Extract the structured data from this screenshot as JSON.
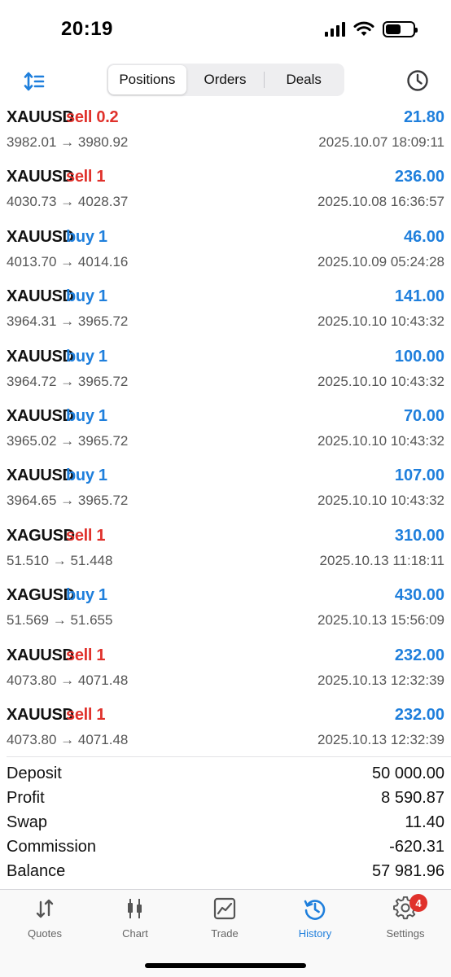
{
  "status": {
    "time": "20:19"
  },
  "tabs": [
    {
      "label": "Positions",
      "active": true
    },
    {
      "label": "Orders",
      "active": false
    },
    {
      "label": "Deals",
      "active": false
    }
  ],
  "trades": [
    {
      "symbol": "XAUUSD",
      "side": "sell",
      "volume": "sell 0.2",
      "profit": "21.80",
      "prices": "3982.01 → 3980.92",
      "datetime": "2025.10.07 18:09:11"
    },
    {
      "symbol": "XAUUSD",
      "side": "sell",
      "volume": "sell 1",
      "profit": "236.00",
      "prices": "4030.73 → 4028.37",
      "datetime": "2025.10.08 16:36:57"
    },
    {
      "symbol": "XAUUSD",
      "side": "buy",
      "volume": "buy 1",
      "profit": "46.00",
      "prices": "4013.70 → 4014.16",
      "datetime": "2025.10.09 05:24:28"
    },
    {
      "symbol": "XAUUSD",
      "side": "buy",
      "volume": "buy 1",
      "profit": "141.00",
      "prices": "3964.31 → 3965.72",
      "datetime": "2025.10.10 10:43:32"
    },
    {
      "symbol": "XAUUSD",
      "side": "buy",
      "volume": "buy 1",
      "profit": "100.00",
      "prices": "3964.72 → 3965.72",
      "datetime": "2025.10.10 10:43:32"
    },
    {
      "symbol": "XAUUSD",
      "side": "buy",
      "volume": "buy 1",
      "profit": "70.00",
      "prices": "3965.02 → 3965.72",
      "datetime": "2025.10.10 10:43:32"
    },
    {
      "symbol": "XAUUSD",
      "side": "buy",
      "volume": "buy 1",
      "profit": "107.00",
      "prices": "3964.65 → 3965.72",
      "datetime": "2025.10.10 10:43:32"
    },
    {
      "symbol": "XAGUSD",
      "side": "sell",
      "volume": "sell 1",
      "profit": "310.00",
      "prices": "51.510 → 51.448",
      "datetime": "2025.10.13 11:18:11"
    },
    {
      "symbol": "XAGUSD",
      "side": "buy",
      "volume": "buy 1",
      "profit": "430.00",
      "prices": "51.569 → 51.655",
      "datetime": "2025.10.13 15:56:09"
    },
    {
      "symbol": "XAUUSD",
      "side": "sell",
      "volume": "sell 1",
      "profit": "232.00",
      "prices": "4073.80 → 4071.48",
      "datetime": "2025.10.13 12:32:39"
    },
    {
      "symbol": "XAUUSD",
      "side": "sell",
      "volume": "sell 1",
      "profit": "232.00",
      "prices": "4073.80 → 4071.48",
      "datetime": "2025.10.13 12:32:39"
    }
  ],
  "summary": [
    {
      "label": "Deposit",
      "value": "50 000.00"
    },
    {
      "label": "Profit",
      "value": "8 590.87"
    },
    {
      "label": "Swap",
      "value": "11.40"
    },
    {
      "label": "Commission",
      "value": "-620.31"
    },
    {
      "label": "Balance",
      "value": "57 981.96"
    }
  ],
  "tabbar": [
    {
      "label": "Quotes",
      "icon": "quotes-icon",
      "active": false
    },
    {
      "label": "Chart",
      "icon": "chart-icon",
      "active": false
    },
    {
      "label": "Trade",
      "icon": "trade-icon",
      "active": false
    },
    {
      "label": "History",
      "icon": "history-icon",
      "active": true
    },
    {
      "label": "Settings",
      "icon": "settings-icon",
      "active": false,
      "badge": "4"
    }
  ],
  "colors": {
    "accent": "#1f7fdc",
    "sell": "#e0312b",
    "buy": "#1f7fdc",
    "badge": "#e0312b"
  }
}
